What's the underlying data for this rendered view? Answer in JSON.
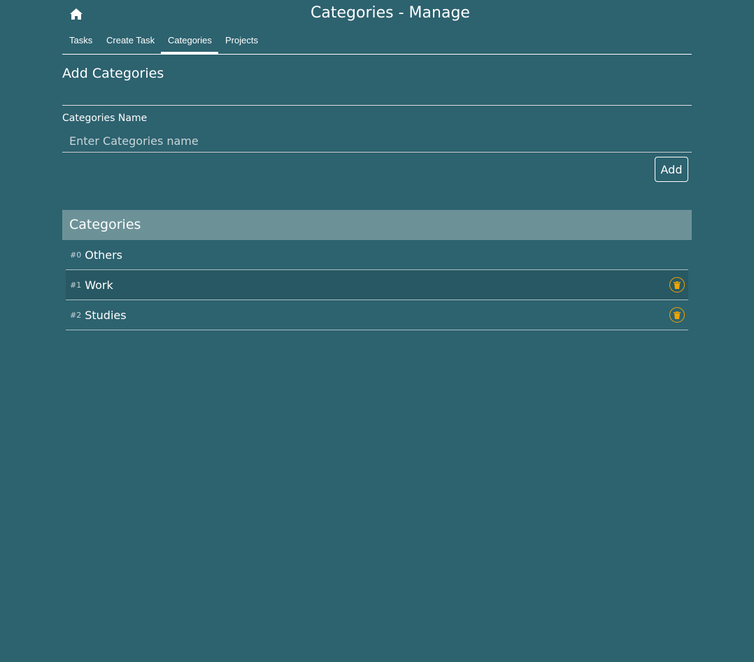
{
  "header": {
    "title": "Categories - Manage",
    "home_icon": "home-icon"
  },
  "nav": {
    "items": [
      {
        "label": "Tasks"
      },
      {
        "label": "Create Task"
      },
      {
        "label": "Categories",
        "active": true
      },
      {
        "label": "Projects"
      }
    ]
  },
  "form": {
    "heading": "Add Categories",
    "field_label": "Categories Name",
    "placeholder": "Enter Categories name",
    "value": "",
    "add_label": "Add"
  },
  "list": {
    "heading": "Categories",
    "items": [
      {
        "num": "#0",
        "name": "Others",
        "deletable": false
      },
      {
        "num": "#1",
        "name": "Work",
        "deletable": true
      },
      {
        "num": "#2",
        "name": "Studies",
        "deletable": true
      }
    ]
  },
  "colors": {
    "background": "#2d626f",
    "list_header": "#6c9298",
    "delete_accent": "#f0a500"
  }
}
